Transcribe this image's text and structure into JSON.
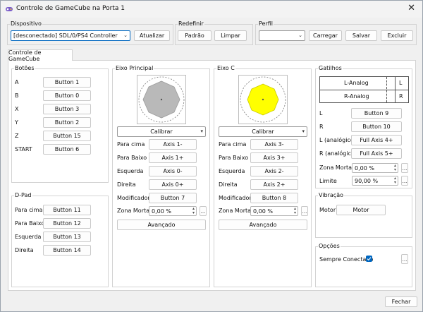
{
  "window": {
    "title": "Controle de GameCube na Porta 1"
  },
  "dispositivo": {
    "title": "Dispositivo",
    "device_value": "[desconectado] SDL/0/PS4 Controller",
    "refresh": "Atualizar"
  },
  "redefinir": {
    "title": "Redefinir",
    "default": "Padrão",
    "clear": "Limpar"
  },
  "perfil": {
    "title": "Perfil",
    "profile_value": "",
    "load": "Carregar",
    "save": "Salvar",
    "delete": "Excluir"
  },
  "tab": {
    "label": "Controle de GameCube"
  },
  "botoes": {
    "title": "Botões",
    "rows": [
      {
        "label": "A",
        "binding": "Button 1"
      },
      {
        "label": "B",
        "binding": "Button 0"
      },
      {
        "label": "X",
        "binding": "Button 3"
      },
      {
        "label": "Y",
        "binding": "Button 2"
      },
      {
        "label": "Z",
        "binding": "Button 15"
      },
      {
        "label": "START",
        "binding": "Button 6"
      }
    ]
  },
  "dpad": {
    "title": "D-Pad",
    "rows": [
      {
        "label": "Para cima",
        "binding": "Button 11"
      },
      {
        "label": "Para Baixo",
        "binding": "Button 12"
      },
      {
        "label": "Esquerda",
        "binding": "Button 13"
      },
      {
        "label": "Direita",
        "binding": "Button 14"
      }
    ]
  },
  "eixo_principal": {
    "title": "Eixo Principal",
    "calibrate": "Calibrar",
    "rows": [
      {
        "label": "Para cima",
        "binding": "Axis 1-"
      },
      {
        "label": "Para Baixo",
        "binding": "Axis 1+"
      },
      {
        "label": "Esquerda",
        "binding": "Axis 0-"
      },
      {
        "label": "Direita",
        "binding": "Axis 0+"
      },
      {
        "label": "Modificador",
        "binding": "Button 7"
      }
    ],
    "deadzone_label": "Zona Morta",
    "deadzone_value": "0,00 %",
    "advanced": "Avançado",
    "more": "...",
    "fill_color": "#b9b9b9"
  },
  "eixo_c": {
    "title": "Eixo C",
    "calibrate": "Calibrar",
    "rows": [
      {
        "label": "Para cima",
        "binding": "Axis 3-"
      },
      {
        "label": "Para Baixo",
        "binding": "Axis 3+"
      },
      {
        "label": "Esquerda",
        "binding": "Axis 2-"
      },
      {
        "label": "Direita",
        "binding": "Axis 2+"
      },
      {
        "label": "Modificador",
        "binding": "Button 8"
      }
    ],
    "deadzone_label": "Zona Morta",
    "deadzone_value": "0,00 %",
    "advanced": "Avançado",
    "more": "...",
    "fill_color": "#ffff00"
  },
  "gatilhos": {
    "title": "Gatilhos",
    "l_analog": "L-Analog",
    "r_analog": "R-Analog",
    "l_letter": "L",
    "r_letter": "R",
    "rows": [
      {
        "label": "L",
        "binding": "Button 9"
      },
      {
        "label": "R",
        "binding": "Button 10"
      },
      {
        "label": "L (analógico)",
        "binding": "Full Axis 4+"
      },
      {
        "label": "R (analógico)",
        "binding": "Full Axis 5+"
      }
    ],
    "deadzone_label": "Zona Morta",
    "deadzone_value": "0,00 %",
    "limit_label": "Limite",
    "limit_value": "90,00 %",
    "more": "..."
  },
  "vibracao": {
    "title": "Vibração",
    "motor_label": "Motor",
    "motor_binding": "Motor"
  },
  "opcoes": {
    "title": "Opções",
    "always_connected": "Sempre Conectado",
    "more": "..."
  },
  "footer": {
    "close": "Fechar"
  },
  "colors": {
    "accent": "#0067c0",
    "window_bg": "#f0f0f0"
  }
}
